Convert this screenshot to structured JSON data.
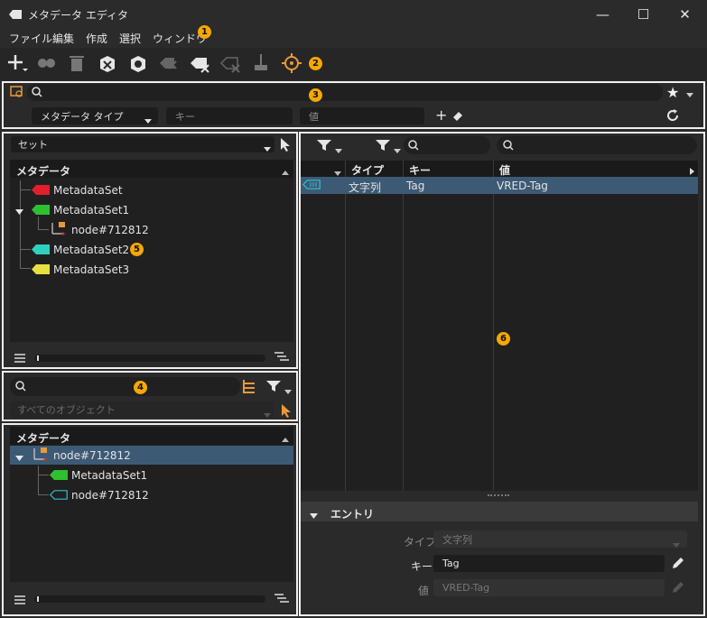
{
  "window": {
    "title": "メタデータ エディタ",
    "min": "—",
    "max": "☐",
    "close": "✕"
  },
  "menu": [
    "ファイル",
    "編集",
    "作成",
    "選択",
    "ウィンドウ"
  ],
  "callouts": [
    "1",
    "2",
    "3",
    "4",
    "5",
    "6"
  ],
  "search": {
    "type_select": "メタデータ タイプ",
    "key_placeholder": "キー",
    "value_placeholder": "値"
  },
  "sets_panel": {
    "dropdown": "セット",
    "header": "メタデータ",
    "items": [
      {
        "label": "MetadataSet",
        "color": "#e0202a"
      },
      {
        "label": "MetadataSet1",
        "color": "#2fc02f"
      },
      {
        "label": "node#712812",
        "color": "#e89a3a"
      },
      {
        "label": "MetadataSet2",
        "color": "#30d0c0"
      },
      {
        "label": "MetadataSet3",
        "color": "#e8e040"
      }
    ]
  },
  "objects_panel": {
    "filter_placeholder": "すべてのオブジェクト",
    "header": "メタデータ",
    "items": [
      {
        "label": "node#712812"
      },
      {
        "label": "MetadataSet1"
      },
      {
        "label": "node#712812"
      }
    ]
  },
  "table": {
    "headers": [
      "タイプ",
      "キー",
      "値"
    ],
    "rows": [
      [
        "文字列",
        "Tag",
        "VRED-Tag"
      ]
    ]
  },
  "entry": {
    "section": "エントリ",
    "type_label": "タイプ",
    "type_value": "文字列",
    "key_label": "キー",
    "key_value": "Tag",
    "value_label": "値",
    "value_value": "VRED-Tag"
  }
}
